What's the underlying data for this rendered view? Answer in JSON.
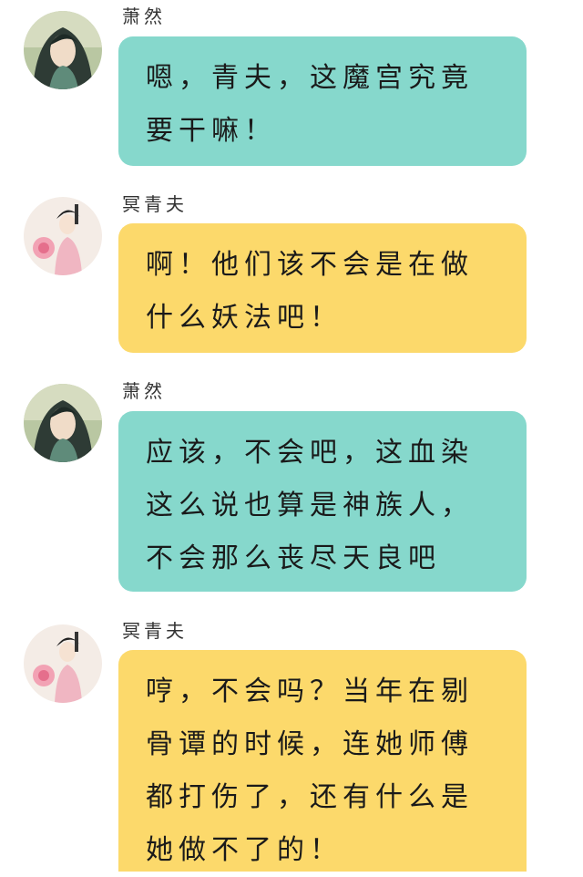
{
  "colors": {
    "xiaoran_bubble": "#86d8cc",
    "mingqingfu_bubble": "#fcd96b",
    "background": "#ffffff"
  },
  "messages": [
    {
      "sender": "萧然",
      "avatar": "xiaoran-avatar",
      "bubble_color": "teal",
      "text": "嗯，青夫，这魔宫究竟要干嘛！"
    },
    {
      "sender": "冥青夫",
      "avatar": "mingqingfu-avatar",
      "bubble_color": "yellow",
      "text": "啊！他们该不会是在做什么妖法吧！"
    },
    {
      "sender": "萧然",
      "avatar": "xiaoran-avatar",
      "bubble_color": "teal",
      "text": "应该，不会吧，这血染这么说也算是神族人，不会那么丧尽天良吧"
    },
    {
      "sender": "冥青夫",
      "avatar": "mingqingfu-avatar",
      "bubble_color": "yellow",
      "text": "哼，不会吗？当年在剔骨谭的时候，连她师傅都打伤了，还有什么是她做不了的！"
    }
  ]
}
